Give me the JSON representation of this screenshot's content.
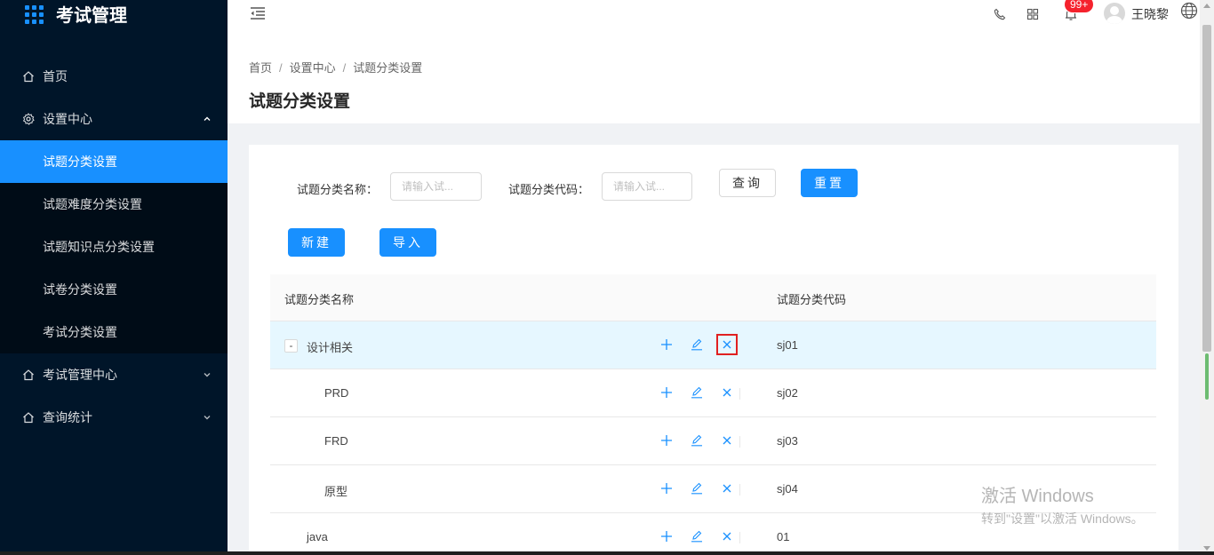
{
  "app": {
    "title": "考试管理"
  },
  "sidebar": {
    "items": [
      {
        "label": "首页",
        "icon": "home-icon"
      },
      {
        "label": "设置中心",
        "icon": "settings-icon",
        "expanded": true,
        "children": [
          {
            "label": "试题分类设置",
            "active": true
          },
          {
            "label": "试题难度分类设置"
          },
          {
            "label": "试题知识点分类设置"
          },
          {
            "label": "试卷分类设置"
          },
          {
            "label": "考试分类设置"
          }
        ]
      },
      {
        "label": "考试管理中心",
        "icon": "home-icon"
      },
      {
        "label": "查询统计",
        "icon": "home-icon"
      }
    ]
  },
  "header": {
    "notification_count": "99+",
    "username": "王晓黎",
    "icons": [
      "menu-fold-icon",
      "phone-icon",
      "apps-icon",
      "bell-icon",
      "avatar",
      "globe-icon"
    ]
  },
  "breadcrumb": [
    "首页",
    "设置中心",
    "试题分类设置"
  ],
  "page": {
    "title": "试题分类设置"
  },
  "search": {
    "name_label": "试题分类名称：",
    "name_placeholder": "请输入试...",
    "code_label": "试题分类代码：",
    "code_placeholder": "请输入试...",
    "query_button": "查询",
    "reset_button": "重置"
  },
  "actions": {
    "new_button": "新建",
    "import_button": "导入"
  },
  "table": {
    "columns": [
      "试题分类名称",
      "试题分类代码"
    ],
    "rows": [
      {
        "name": "设计相关",
        "code": "sj01",
        "level": 0,
        "expandable": true,
        "expand_symbol": "-"
      },
      {
        "name": "PRD",
        "code": "sj02",
        "level": 1
      },
      {
        "name": "FRD",
        "code": "sj03",
        "level": 1
      },
      {
        "name": "原型",
        "code": "sj04",
        "level": 1
      },
      {
        "name": "java",
        "code": "01",
        "level": 0
      }
    ]
  },
  "watermark": {
    "line1": "激活 Windows",
    "line2": "转到\"设置\"以激活 Windows。"
  },
  "colors": {
    "primary": "#1890ff",
    "sidebar_bg": "#001529",
    "submenu_bg": "#000c17",
    "badge": "#f5222d",
    "highlight_outline": "#e02020"
  }
}
